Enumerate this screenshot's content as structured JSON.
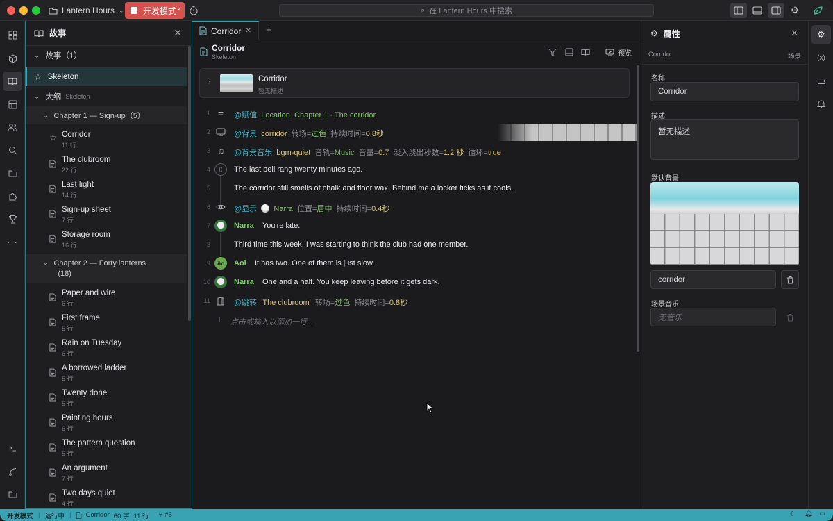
{
  "titlebar": {
    "project": "Lantern Hours",
    "dev_mode": "开发模式",
    "search_placeholder": "在 Lantern Hours 中搜索"
  },
  "left_panel": {
    "title": "故事",
    "story_section": "故事（1）",
    "story_item": "Skeleton",
    "outline_label": "大纲",
    "outline_sub": "Skeleton",
    "chapter1": "Chapter 1 — Sign-up（5）",
    "chapter1_scenes": [
      {
        "title": "Corridor",
        "lines": "11 行"
      },
      {
        "title": "The clubroom",
        "lines": "22 行"
      },
      {
        "title": "Last light",
        "lines": "14 行"
      },
      {
        "title": "Sign-up sheet",
        "lines": "7 行"
      },
      {
        "title": "Storage room",
        "lines": "16 行"
      }
    ],
    "chapter2_line1": "Chapter 2 — Forty lanterns",
    "chapter2_line2": "(18)",
    "chapter2_scenes": [
      {
        "title": "Paper and wire",
        "lines": "6 行"
      },
      {
        "title": "First frame",
        "lines": "5 行"
      },
      {
        "title": "Rain on Tuesday",
        "lines": "6 行"
      },
      {
        "title": "A borrowed ladder",
        "lines": "5 行"
      },
      {
        "title": "Twenty done",
        "lines": "5 行"
      },
      {
        "title": "Painting hours",
        "lines": "6 行"
      },
      {
        "title": "The pattern question",
        "lines": "5 行"
      },
      {
        "title": "An argument",
        "lines": "7 行"
      },
      {
        "title": "Two days quiet",
        "lines": "4 行"
      }
    ]
  },
  "editor": {
    "tab": "Corridor",
    "title": "Corridor",
    "subtitle": "Skeleton",
    "preview": "预览",
    "card_title": "Corridor",
    "card_desc": "暂无描述",
    "lines": {
      "l1": {
        "cmd": "@赋值",
        "a": "Location",
        "b": "Chapter 1 · The corridor"
      },
      "l2": {
        "cmd": "@背景",
        "a": "corridor",
        "p1": "转场=",
        "v1": "过色",
        "p2": "持续时间=",
        "v2": "0.8秒"
      },
      "l3": {
        "cmd": "@背景音乐",
        "a": "bgm-quiet",
        "p1": "音轨=",
        "v1": "Music",
        "p2": "音量=",
        "v2": "0.7",
        "p3": "淡入淡出秒数=",
        "v3": "1.2 秒",
        "p4": "循环=",
        "v4": "true"
      },
      "l4": "The last bell rang twenty minutes ago.",
      "l5": "The corridor still smells of chalk and floor wax. Behind me a locker ticks as it cools.",
      "l6": {
        "cmd": "@显示",
        "a": "Narra",
        "p1": "位置=",
        "v1": "居中",
        "p2": "持续时间=",
        "v2": "0.4秒"
      },
      "l7": {
        "speaker": "Narra",
        "text": "You're late."
      },
      "l8": "Third time this week. I was starting to think the club had one member.",
      "l9": {
        "speaker": "Aoi",
        "avatar": "Ao",
        "text": "It has two. One of them is just slow."
      },
      "l10": {
        "speaker": "Narra",
        "text": "One and a half. You keep leaving before it gets dark."
      },
      "l11": {
        "cmd": "@跳转",
        "a": "'The clubroom'",
        "p1": "转场=",
        "v1": "过色",
        "p2": "持续时间=",
        "v2": "0.8秒"
      }
    },
    "add_line": "点击或输入以添加一行..."
  },
  "right_panel": {
    "title": "属性",
    "type_label": "Corridor",
    "type_value": "场景",
    "name_label": "名称",
    "name_value": "Corridor",
    "desc_label": "描述",
    "desc_value": "暂无描述",
    "bg_label": "默认背景",
    "bg_value": "corridor",
    "music_label": "场景音乐",
    "music_placeholder": "无音乐"
  },
  "statusbar": {
    "mode": "开发模式",
    "run": "运行中",
    "scene": "Corridor",
    "words": "60 字",
    "lines": "11 行",
    "branch": "#5"
  },
  "colors": {
    "accent": "#3aa3b3",
    "dev_red": "#d4534f",
    "command": "#4fb3c4",
    "keyword": "#7fbf6a",
    "value": "#d8c37a"
  }
}
